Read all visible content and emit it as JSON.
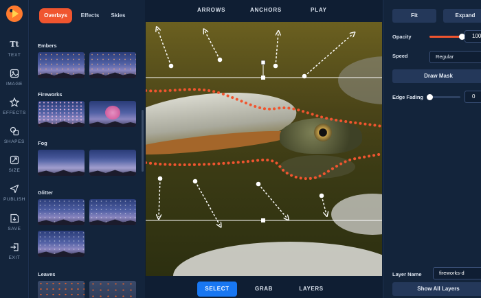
{
  "rail": {
    "items": [
      {
        "label": "TEXT",
        "icon": "text-icon"
      },
      {
        "label": "IMAGE",
        "icon": "image-icon"
      },
      {
        "label": "EFFECTS",
        "icon": "star-icon"
      },
      {
        "label": "SHAPES",
        "icon": "shapes-icon"
      },
      {
        "label": "SIZE",
        "icon": "resize-icon"
      },
      {
        "label": "PUBLISH",
        "icon": "send-icon"
      },
      {
        "label": "SAVE",
        "icon": "save-icon"
      },
      {
        "label": "EXIT",
        "icon": "exit-icon"
      }
    ],
    "text_glyph": "Tt"
  },
  "panel": {
    "tabs": [
      {
        "label": "Overlays",
        "active": true
      },
      {
        "label": "Effects",
        "active": false
      },
      {
        "label": "Skies",
        "active": false
      }
    ],
    "sections": [
      {
        "title": "Embers"
      },
      {
        "title": "Fireworks"
      },
      {
        "title": "Fog"
      },
      {
        "title": "Glitter"
      },
      {
        "title": "Leaves"
      }
    ]
  },
  "canvas": {
    "topbar": [
      "ARROWS",
      "ANCHORS",
      "PLAY"
    ],
    "bottombar": [
      {
        "label": "SELECT",
        "active": true
      },
      {
        "label": "GRAB",
        "active": false
      },
      {
        "label": "LAYERS",
        "active": false
      }
    ]
  },
  "props": {
    "fit_label": "Fit",
    "expand_label": "Expand",
    "opacity_label": "Opacity",
    "opacity_value": "100",
    "opacity_fraction": 1.0,
    "speed_label": "Speed",
    "speed_value": "Regular",
    "draw_mask_label": "Draw Mask",
    "edge_fading_label": "Edge Fading",
    "edge_fading_value": "0",
    "edge_fading_fraction": 0.0,
    "layer_name_label": "Layer Name",
    "layer_name_value": "fireworks-d",
    "show_all_label": "Show All Layers"
  },
  "colors": {
    "accent": "#f0552f",
    "select_blue": "#1877f2",
    "panel_bg": "#13243b"
  }
}
